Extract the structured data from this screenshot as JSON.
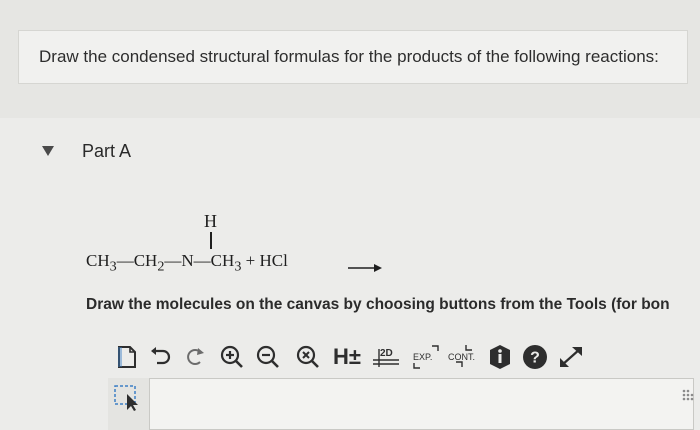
{
  "question": {
    "text": "Draw the condensed structural formulas for the products of the following reactions:"
  },
  "part": {
    "title": "Part A",
    "toggle_icon": "caret-down-icon"
  },
  "reaction": {
    "h_atom": "H",
    "left": "CH",
    "s3a": "3",
    "b1": "—CH",
    "s2": "2",
    "b2": "—N—CH",
    "s3b": "3",
    "plus": " + HCl "
  },
  "instruction": {
    "text": "Draw the molecules on the canvas by choosing buttons from the Tools (for bon"
  },
  "toolbar": {
    "tools": [
      {
        "name": "new-canvas-icon"
      },
      {
        "name": "undo-icon"
      },
      {
        "name": "redo-icon"
      },
      {
        "name": "zoom-in-icon"
      },
      {
        "name": "zoom-out-icon"
      },
      {
        "name": "clear-icon"
      },
      {
        "name": "hydrogen-toggle-icon",
        "label": "H±"
      },
      {
        "name": "2d-clean-icon",
        "label": "2D"
      },
      {
        "name": "expand-icon",
        "label": "EXP."
      },
      {
        "name": "contract-icon",
        "label": "CONT."
      },
      {
        "name": "info-icon"
      },
      {
        "name": "help-icon"
      },
      {
        "name": "fullscreen-icon"
      }
    ]
  },
  "colors": {
    "background": "#e9e9e6",
    "dark_icon": "#2e2e2e",
    "arrow_blue": "#3c7fc6"
  }
}
